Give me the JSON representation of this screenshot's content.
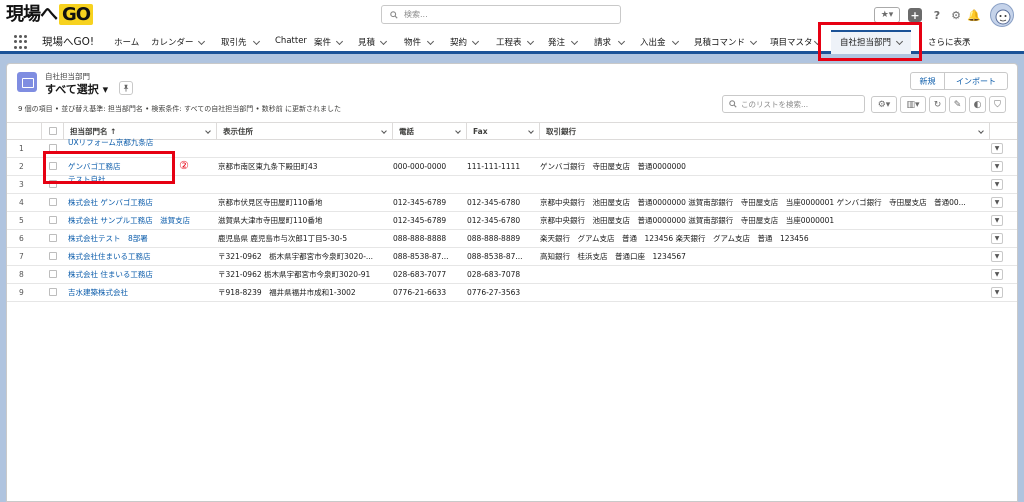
{
  "header": {
    "logo_text": "現場へ",
    "logo_go": "GO",
    "search_placeholder": "検索...",
    "fav_icon": "★▾",
    "add_icon": "+",
    "help_icon": "?",
    "gear_icon": "⚙",
    "bell_icon": "🔔"
  },
  "nav": {
    "app_name": "現場へGO!",
    "items": [
      {
        "label": "ホーム"
      },
      {
        "label": "カレンダー"
      },
      {
        "label": "取引先"
      },
      {
        "label": "Chatter"
      },
      {
        "label": "案件"
      },
      {
        "label": "見積"
      },
      {
        "label": "物件"
      },
      {
        "label": "契約"
      },
      {
        "label": "工程表"
      },
      {
        "label": "発注"
      },
      {
        "label": "請求"
      },
      {
        "label": "入出金"
      },
      {
        "label": "見積コマンド"
      },
      {
        "label": "項目マスタ"
      },
      {
        "label": "自社担当部門"
      },
      {
        "label": "さらに表示"
      }
    ]
  },
  "annotations": {
    "one": "①",
    "two": "②"
  },
  "list": {
    "object_label": "自社担当部門",
    "view_name": "すべて選択 ▾",
    "pin_icon": "📌",
    "new_button": "新規",
    "import_button": "インポート",
    "meta": "9 個の項目 • 並び替え基準: 担当部門名 • 検索条件: すべての自社担当部門 • 数秒前 に更新されました",
    "search_placeholder": "このリストを検索...",
    "columns": {
      "name": "担当部門名 ↑",
      "address": "表示住所",
      "phone": "電話",
      "fax": "Fax",
      "bank": "取引銀行"
    },
    "rows": [
      {
        "n": "1",
        "name": "UXリフォーム京都九条店",
        "address": "",
        "phone": "",
        "fax": "",
        "bank": ""
      },
      {
        "n": "2",
        "name": "ゲンバゴ工務店",
        "address": "京都市南区東九条下殿田町43",
        "phone": "000-000-0000",
        "fax": "111-111-1111",
        "bank": "ゲンバゴ銀行　寺田屋支店　普通0000000"
      },
      {
        "n": "3",
        "name": "テスト自社",
        "address": "",
        "phone": "",
        "fax": "",
        "bank": ""
      },
      {
        "n": "4",
        "name": "株式会社 ゲンバゴ工務店",
        "address": "京都市伏見区寺田屋町110番地",
        "phone": "012-345-6789",
        "fax": "012-345-6780",
        "bank": "京都中央銀行　池田屋支店　普通0000000 滋賀南部銀行　寺田屋支店　当座0000001 ゲンバゴ銀行　寺田屋支店　普通00..."
      },
      {
        "n": "5",
        "name": "株式会社 サンプル工務店　滋賀支店",
        "address": "滋賀県大津市寺田屋町110番地",
        "phone": "012-345-6789",
        "fax": "012-345-6780",
        "bank": "京都中央銀行　池田屋支店　普通0000000 滋賀南部銀行　寺田屋支店　当座0000001"
      },
      {
        "n": "6",
        "name": "株式会社テスト　8部署",
        "address": "鹿児島県 鹿児島市与次郎1丁目5-30-5",
        "phone": "088-888-8888",
        "fax": "088-888-8889",
        "bank": "楽天銀行　グアム支店　普通　123456 楽天銀行　グアム支店　普通　123456"
      },
      {
        "n": "7",
        "name": "株式会社住まいる工務店",
        "address": "〒321-0962　栃木県宇都宮市今泉町3020-...",
        "phone": "088-8538-87...",
        "fax": "088-8538-87...",
        "bank": "高知銀行　桂浜支店　普通口座　1234567"
      },
      {
        "n": "8",
        "name": "株式会社 住まいる工務店",
        "address": "〒321-0962 栃木県宇都宮市今泉町3020-91",
        "phone": "028-683-7077",
        "fax": "028-683-7078",
        "bank": ""
      },
      {
        "n": "9",
        "name": "吉水建築株式会社",
        "address": "〒918-8239　福井県福井市成和1-3002",
        "phone": "0776-21-6633",
        "fax": "0776-27-3563",
        "bank": ""
      }
    ]
  },
  "colors": {
    "brand": "#1b5297",
    "link": "#0b5cab",
    "annotation": "#e60012"
  }
}
